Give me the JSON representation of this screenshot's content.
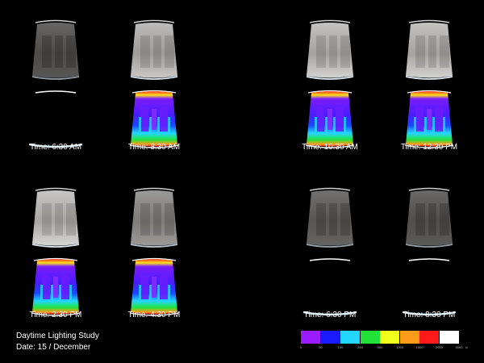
{
  "panels": [
    {
      "time": "Time: 6:30 AM",
      "brightness": 0.28,
      "heatmap": false
    },
    {
      "time": "Time: 8:30 AM",
      "brightness": 0.85,
      "heatmap": true
    },
    {
      "time": "Time: 10:30 AM",
      "brightness": 0.9,
      "heatmap": true
    },
    {
      "time": "Time: 12:30 PM",
      "brightness": 0.9,
      "heatmap": true
    },
    {
      "time": "Time: 2:30 PM",
      "brightness": 0.92,
      "heatmap": true
    },
    {
      "time": "Time: 4:30 PM",
      "brightness": 0.62,
      "heatmap": true
    },
    {
      "time": "Time: 6:30 PM",
      "brightness": 0.35,
      "heatmap": false
    },
    {
      "time": "Time: 8:30 PM",
      "brightness": 0.3,
      "heatmap": false
    }
  ],
  "footer": {
    "title": "Daytime Lighting Study",
    "date": "Date: 15 / December"
  },
  "legend": {
    "colors": [
      "#9b1cff",
      "#1a1aff",
      "#22d6ff",
      "#22e23a",
      "#f2ff1a",
      "#ff9b1a",
      "#ff1a1a",
      "#ffffff"
    ],
    "ticks": [
      "0",
      "50",
      "100",
      "250",
      "500",
      "1000",
      "1500",
      "2000",
      "3000"
    ],
    "unit": "lx"
  }
}
